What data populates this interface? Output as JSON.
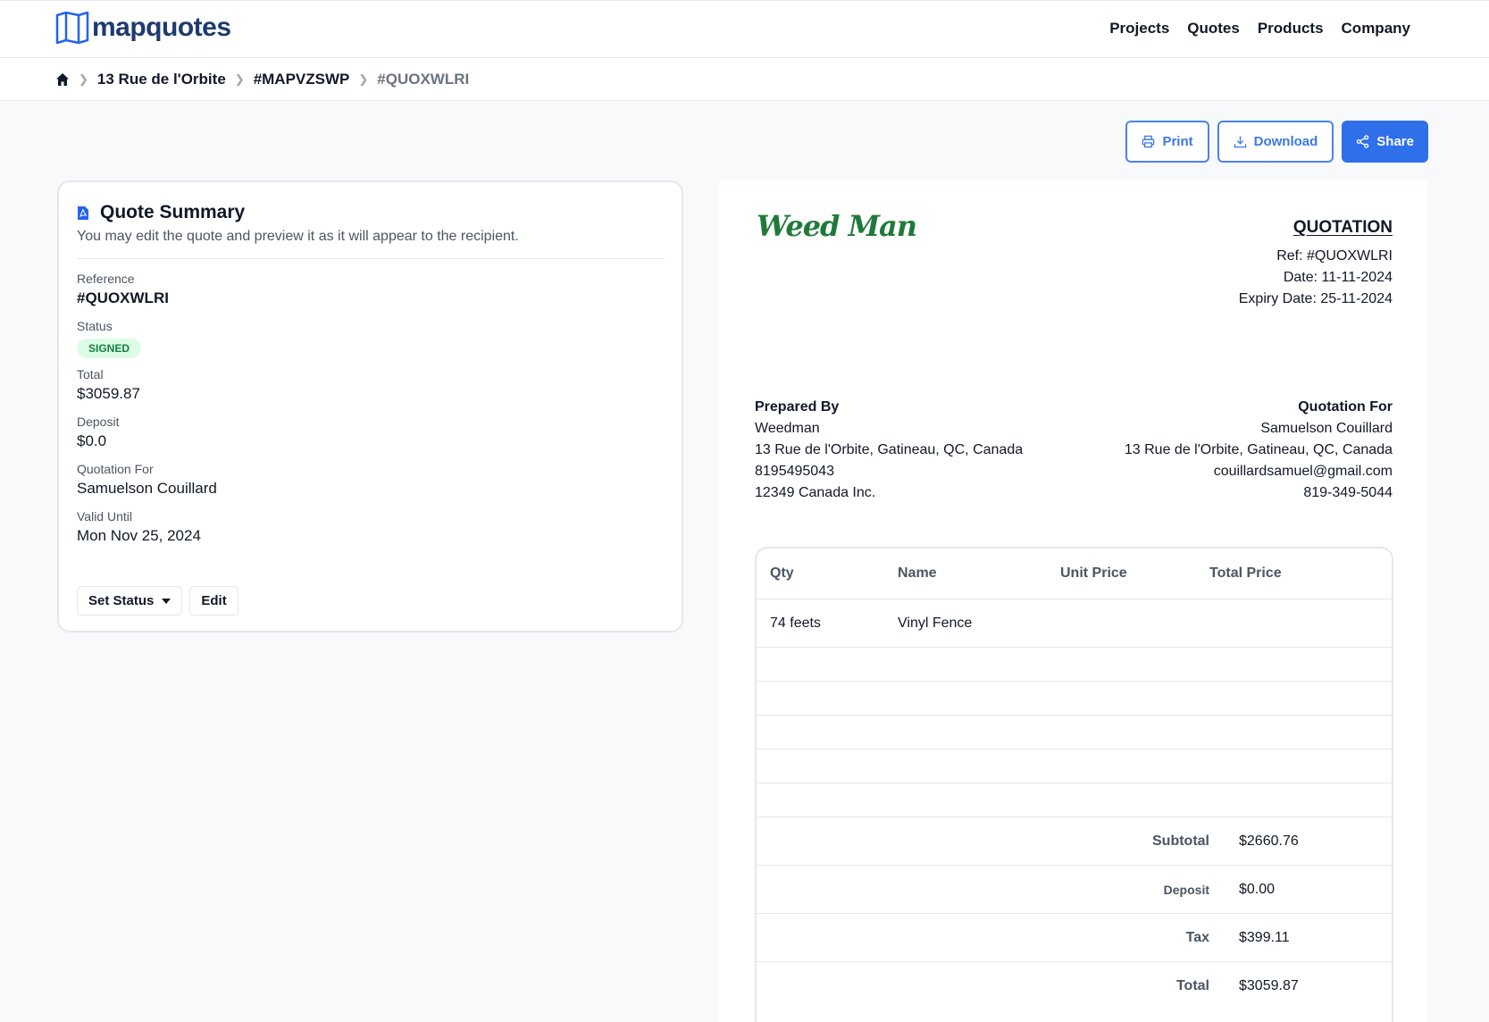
{
  "brand": {
    "name": "mapquotes",
    "color": "#1e3a6e"
  },
  "nav": [
    "Projects",
    "Quotes",
    "Products",
    "Company"
  ],
  "breadcrumb": {
    "home_icon": "home-icon",
    "items": [
      "13 Rue de l'Orbite",
      "#MAPVZSWP",
      "#QUOXWLRI"
    ]
  },
  "actions": {
    "print": "Print",
    "download": "Download",
    "share": "Share"
  },
  "summary": {
    "title": "Quote Summary",
    "description": "You may edit the quote and preview it as it will appear to the recipient.",
    "reference_label": "Reference",
    "reference": "#QUOXWLRI",
    "status_label": "Status",
    "status": "SIGNED",
    "total_label": "Total",
    "total": "$3059.87",
    "deposit_label": "Deposit",
    "deposit": "$0.0",
    "for_label": "Quotation For",
    "for": "Samuelson Couillard",
    "valid_label": "Valid Until",
    "valid": "Mon Nov 25, 2024",
    "set_status": "Set Status",
    "edit": "Edit"
  },
  "document": {
    "logo_text": "Weed Man",
    "logo_color": "#1f7a3a",
    "title": "QUOTATION",
    "ref": "Ref: #QUOXWLRI",
    "date": "Date: 11-11-2024",
    "expiry": "Expiry Date: 25-11-2024",
    "prepared_by": {
      "heading": "Prepared By",
      "lines": [
        "Weedman",
        "13 Rue de l'Orbite, Gatineau, QC, Canada",
        "8195495043",
        "12349 Canada Inc."
      ]
    },
    "quotation_for": {
      "heading": "Quotation For",
      "lines": [
        "Samuelson Couillard",
        "13 Rue de l'Orbite, Gatineau, QC, Canada",
        "couillardsamuel@gmail.com",
        "819-349-5044"
      ]
    },
    "table": {
      "headers": [
        "Qty",
        "Name",
        "Unit Price",
        "Total Price"
      ],
      "rows": [
        {
          "qty": "74 feets",
          "name": "Vinyl Fence",
          "unit": "",
          "total": ""
        }
      ],
      "subtotal_label": "Subtotal",
      "subtotal": "$2660.76",
      "deposit_label": "Deposit",
      "deposit": "$0.00",
      "tax_label": "Tax",
      "tax": "$399.11",
      "total_label": "Total",
      "total": "$3059.87"
    }
  }
}
